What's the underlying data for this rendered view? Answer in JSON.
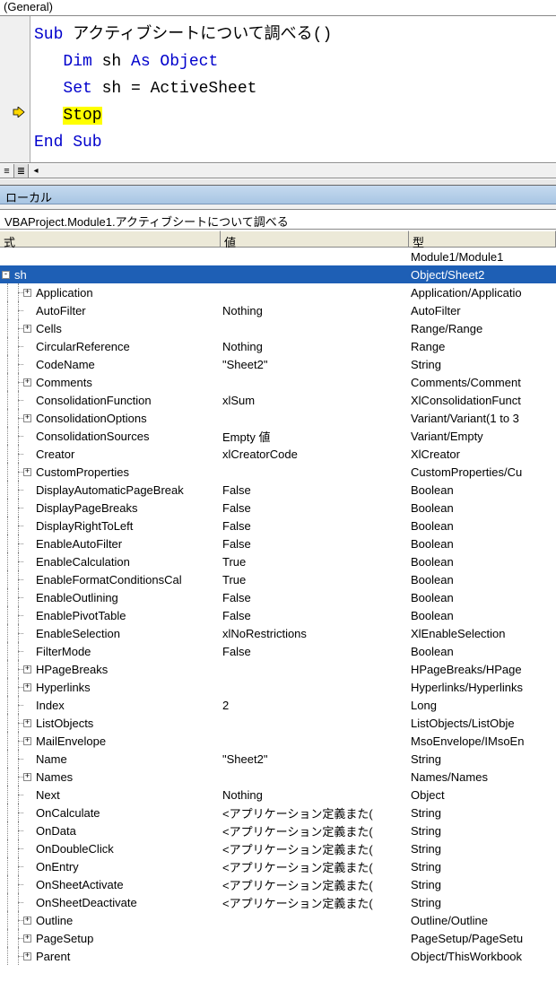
{
  "dropdown": {
    "general": "(General)"
  },
  "code": {
    "sub_kw": "Sub",
    "sub_name": " アクティブシートについて調べる()",
    "dim_kw": "Dim",
    "dim_var": " sh ",
    "as_obj": "As Object",
    "set_kw": "Set",
    "set_expr": " sh = ActiveSheet",
    "stop": "Stop",
    "end_sub": "End Sub"
  },
  "panel": {
    "title": "ローカル",
    "context": "VBAProject.Module1.アクティブシートについて調べる"
  },
  "headers": {
    "expr": "式",
    "val": "値",
    "type": "型"
  },
  "root": {
    "module_type": "Module1/Module1",
    "sh": {
      "name": "sh",
      "val": "",
      "type": "Object/Sheet2"
    }
  },
  "props": [
    {
      "n": "Application",
      "v": "",
      "t": "Application/Applicatio",
      "e": true
    },
    {
      "n": "AutoFilter",
      "v": "Nothing",
      "t": "AutoFilter",
      "e": false
    },
    {
      "n": "Cells",
      "v": "",
      "t": "Range/Range",
      "e": true
    },
    {
      "n": "CircularReference",
      "v": "Nothing",
      "t": "Range",
      "e": false
    },
    {
      "n": "CodeName",
      "v": "\"Sheet2\"",
      "t": "String",
      "e": false
    },
    {
      "n": "Comments",
      "v": "",
      "t": "Comments/Comment",
      "e": true
    },
    {
      "n": "ConsolidationFunction",
      "v": "xlSum",
      "t": "XlConsolidationFunct",
      "e": false
    },
    {
      "n": "ConsolidationOptions",
      "v": "",
      "t": "Variant/Variant(1 to 3",
      "e": true
    },
    {
      "n": "ConsolidationSources",
      "v": "Empty 値",
      "t": "Variant/Empty",
      "e": false
    },
    {
      "n": "Creator",
      "v": "xlCreatorCode",
      "t": "XlCreator",
      "e": false
    },
    {
      "n": "CustomProperties",
      "v": "",
      "t": "CustomProperties/Cu",
      "e": true
    },
    {
      "n": "DisplayAutomaticPageBreak",
      "v": "False",
      "t": "Boolean",
      "e": false
    },
    {
      "n": "DisplayPageBreaks",
      "v": "False",
      "t": "Boolean",
      "e": false
    },
    {
      "n": "DisplayRightToLeft",
      "v": "False",
      "t": "Boolean",
      "e": false
    },
    {
      "n": "EnableAutoFilter",
      "v": "False",
      "t": "Boolean",
      "e": false
    },
    {
      "n": "EnableCalculation",
      "v": "True",
      "t": "Boolean",
      "e": false
    },
    {
      "n": "EnableFormatConditionsCal",
      "v": "True",
      "t": "Boolean",
      "e": false
    },
    {
      "n": "EnableOutlining",
      "v": "False",
      "t": "Boolean",
      "e": false
    },
    {
      "n": "EnablePivotTable",
      "v": "False",
      "t": "Boolean",
      "e": false
    },
    {
      "n": "EnableSelection",
      "v": "xlNoRestrictions",
      "t": "XlEnableSelection",
      "e": false
    },
    {
      "n": "FilterMode",
      "v": "False",
      "t": "Boolean",
      "e": false
    },
    {
      "n": "HPageBreaks",
      "v": "",
      "t": "HPageBreaks/HPage",
      "e": true
    },
    {
      "n": "Hyperlinks",
      "v": "",
      "t": "Hyperlinks/Hyperlinks",
      "e": true
    },
    {
      "n": "Index",
      "v": "2",
      "t": "Long",
      "e": false
    },
    {
      "n": "ListObjects",
      "v": "",
      "t": "ListObjects/ListObje",
      "e": true
    },
    {
      "n": "MailEnvelope",
      "v": "",
      "t": "MsoEnvelope/IMsoEn",
      "e": true
    },
    {
      "n": "Name",
      "v": "\"Sheet2\"",
      "t": "String",
      "e": false
    },
    {
      "n": "Names",
      "v": "",
      "t": "Names/Names",
      "e": true
    },
    {
      "n": "Next",
      "v": "Nothing",
      "t": "Object",
      "e": false
    },
    {
      "n": "OnCalculate",
      "v": "<アプリケーション定義また(",
      "t": "String",
      "e": false
    },
    {
      "n": "OnData",
      "v": "<アプリケーション定義また(",
      "t": "String",
      "e": false
    },
    {
      "n": "OnDoubleClick",
      "v": "<アプリケーション定義また(",
      "t": "String",
      "e": false
    },
    {
      "n": "OnEntry",
      "v": "<アプリケーション定義また(",
      "t": "String",
      "e": false
    },
    {
      "n": "OnSheetActivate",
      "v": "<アプリケーション定義また(",
      "t": "String",
      "e": false
    },
    {
      "n": "OnSheetDeactivate",
      "v": "<アプリケーション定義また(",
      "t": "String",
      "e": false
    },
    {
      "n": "Outline",
      "v": "",
      "t": "Outline/Outline",
      "e": true
    },
    {
      "n": "PageSetup",
      "v": "",
      "t": "PageSetup/PageSetu",
      "e": true
    },
    {
      "n": "Parent",
      "v": "",
      "t": "Object/ThisWorkbook",
      "e": true
    }
  ]
}
